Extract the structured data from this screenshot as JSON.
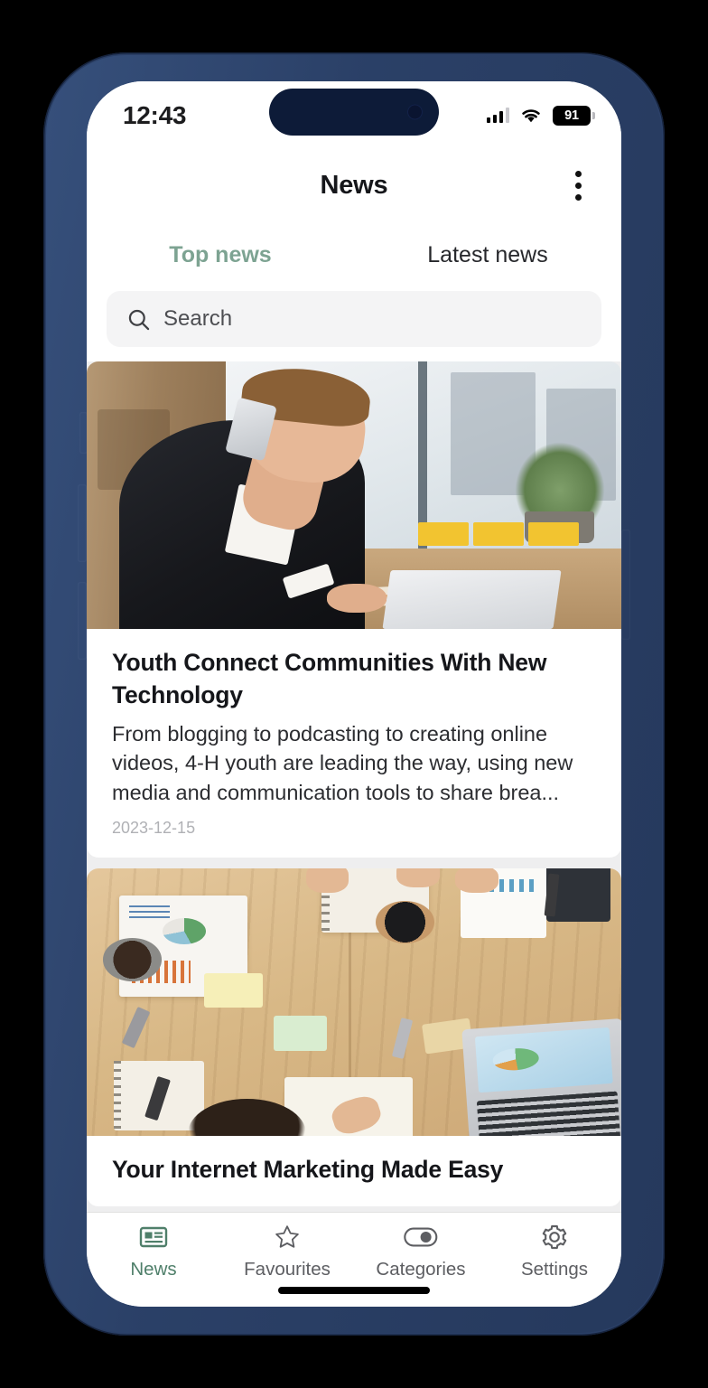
{
  "status_bar": {
    "time": "12:43",
    "signal_icon": "cellular-signal-icon",
    "wifi_icon": "wifi-icon",
    "battery_level": "91"
  },
  "app_bar": {
    "title": "News",
    "menu_icon": "overflow-menu-icon"
  },
  "tabs": [
    {
      "label": "Top news",
      "active": true
    },
    {
      "label": "Latest news",
      "active": false
    }
  ],
  "search": {
    "placeholder": "Search",
    "value": "",
    "icon": "search-icon"
  },
  "articles": [
    {
      "title": "Youth Connect Communities With New Technology",
      "excerpt": "From blogging to podcasting to creating online videos, 4-H youth are leading the way, using new media and communication tools to share brea...",
      "date": "2023-12-15",
      "image_alt": "businessman-on-phone-at-desk"
    },
    {
      "title": "Your Internet Marketing Made Easy",
      "excerpt": "",
      "date": "",
      "image_alt": "overhead-desk-with-charts-and-laptop"
    }
  ],
  "bottom_nav": [
    {
      "label": "News",
      "icon": "newspaper-icon",
      "active": true
    },
    {
      "label": "Favourites",
      "icon": "star-icon",
      "active": false
    },
    {
      "label": "Categories",
      "icon": "toggle-icon",
      "active": false
    },
    {
      "label": "Settings",
      "icon": "gear-icon",
      "active": false
    }
  ],
  "colors": {
    "accent_green": "#7da392",
    "nav_active_green": "#4f7f6a",
    "phone_bezel": "#2a3f66",
    "dynamic_island": "#0d1b38",
    "feed_background": "#eeeeef",
    "search_background": "#f4f4f5"
  }
}
